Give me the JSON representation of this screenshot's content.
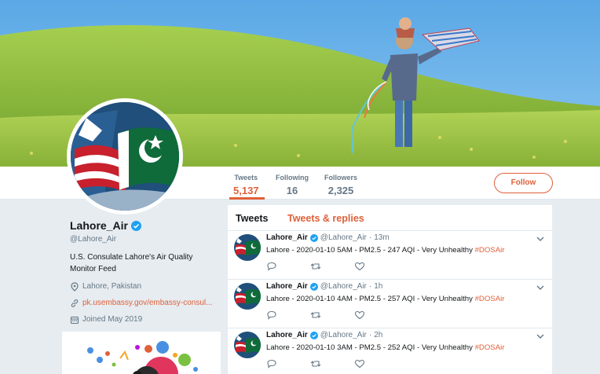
{
  "colors": {
    "accent": "#e0603a",
    "verified": "#1da1f2",
    "muted": "#657786",
    "text": "#14171a",
    "page_bg": "#e6ecf0"
  },
  "nav": {
    "tweets_label": "Tweets",
    "tweets_count": "5,137",
    "following_label": "Following",
    "following_count": "16",
    "followers_label": "Followers",
    "followers_count": "2,325",
    "follow_button": "Follow"
  },
  "profile": {
    "name": "Lahore_Air",
    "handle": "@Lahore_Air",
    "bio": "U.S. Consulate Lahore's Air Quality Monitor Feed",
    "location": "Lahore, Pakistan",
    "website": "pk.usembassy.gov/embassy-consul...",
    "joined": "Joined May 2019",
    "icons": {
      "location": "location-pin-icon",
      "link": "link-icon",
      "joined": "calendar-icon",
      "verified": "verified-badge-icon"
    }
  },
  "timeline": {
    "tab_tweets": "Tweets",
    "tab_replies": "Tweets & replies",
    "tweets": [
      {
        "name": "Lahore_Air",
        "handle": "@Lahore_Air",
        "time": "13m",
        "text": "Lahore - 2020-01-10 5AM - PM2.5 - 247 AQI - Very Unhealthy ",
        "hashtag": "#DOSAir"
      },
      {
        "name": "Lahore_Air",
        "handle": "@Lahore_Air",
        "time": "1h",
        "text": "Lahore - 2020-01-10 4AM - PM2.5 - 257 AQI - Very Unhealthy ",
        "hashtag": "#DOSAir"
      },
      {
        "name": "Lahore_Air",
        "handle": "@Lahore_Air",
        "time": "2h",
        "text": "Lahore - 2020-01-10 3AM - PM2.5 - 252 AQI - Very Unhealthy ",
        "hashtag": "#DOSAir"
      }
    ],
    "action_icons": [
      "reply-icon",
      "retweet-icon",
      "like-icon"
    ]
  }
}
